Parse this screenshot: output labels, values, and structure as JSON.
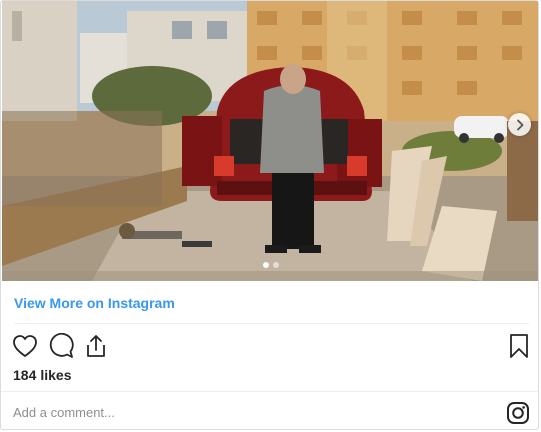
{
  "post": {
    "photo_alt_name": "man-standing-by-red-car-photo",
    "carousel": {
      "total": 2,
      "current": 1
    },
    "view_more_label": "View More on Instagram",
    "likes_count": "184",
    "likes_word": "likes",
    "comment_placeholder": "Add a comment...",
    "link_color": "#3897f0"
  },
  "icons": {
    "like": "heart-icon",
    "comment": "comment-bubble-icon",
    "share": "share-icon",
    "save": "bookmark-icon",
    "next": "chevron-right-icon",
    "brand": "instagram-logo-icon"
  }
}
